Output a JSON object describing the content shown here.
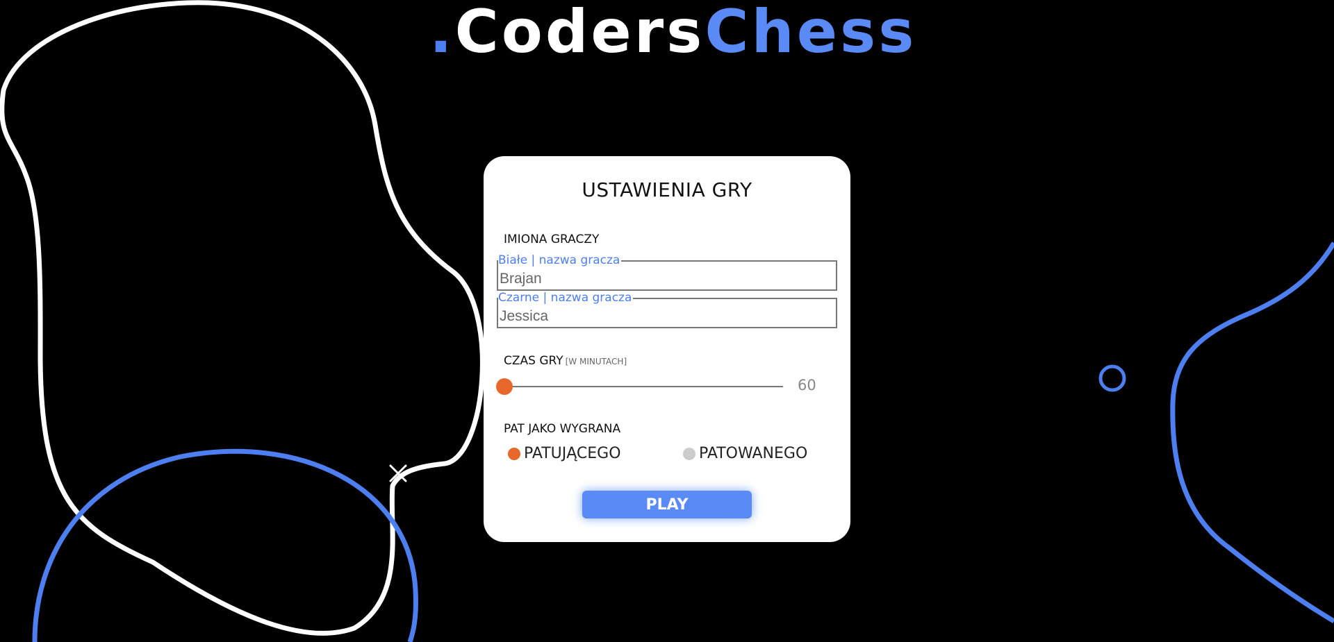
{
  "logo": {
    "dot": ".",
    "part1": "Coders",
    "part2": "Chess"
  },
  "card": {
    "title": "USTAWIENIA GRY",
    "players_label": "IMIONA GRACZY",
    "white_field": {
      "legend": "Białe | nazwa gracza",
      "value": "Brajan"
    },
    "black_field": {
      "legend": "Czarne | nazwa gracza",
      "value": "Jessica"
    },
    "time_label": "CZAS GRY",
    "time_hint": "[W MINUTACH]",
    "time_value": "60",
    "stalemate_label": "PAT JAKO WYGRANA",
    "options": [
      {
        "label": "PATUJĄCEGO",
        "selected": true,
        "color": "#e8672a"
      },
      {
        "label": "PATOWANEGO",
        "selected": false,
        "color": "#cccccc"
      }
    ],
    "play_label": "PLAY"
  },
  "colors": {
    "accent_blue": "#5a8af5",
    "accent_orange": "#e8672a",
    "background": "#000000",
    "card": "#ffffff"
  }
}
